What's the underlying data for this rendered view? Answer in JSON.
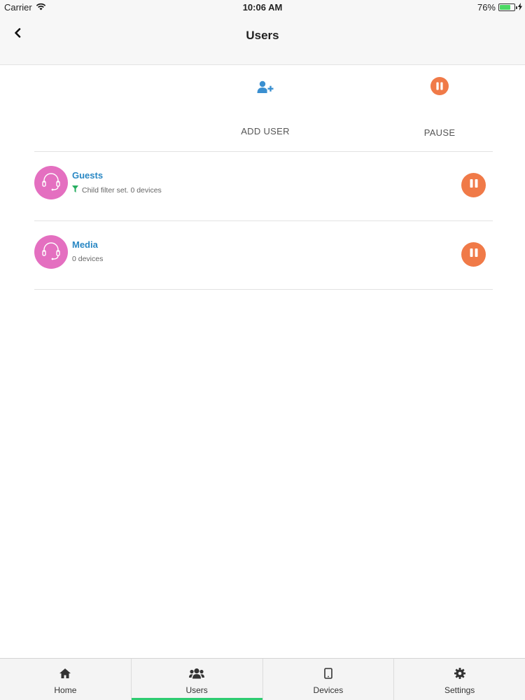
{
  "status_bar": {
    "carrier": "Carrier",
    "time": "10:06 AM",
    "battery": "76%",
    "battery_level": 0.76
  },
  "nav": {
    "title": "Users"
  },
  "actions": {
    "add_user_label": "ADD USER",
    "pause_label": "PAUSE",
    "add_user_icon": "add-user-icon",
    "pause_icon": "pause-icon"
  },
  "users": [
    {
      "name": "Guests",
      "subtitle": "Child filter set. 0 devices",
      "has_filter": true
    },
    {
      "name": "Media",
      "subtitle": "0 devices",
      "has_filter": false
    }
  ],
  "tabs": [
    {
      "label": "Home",
      "icon": "home-icon",
      "active": false
    },
    {
      "label": "Users",
      "icon": "users-icon",
      "active": true
    },
    {
      "label": "Devices",
      "icon": "tablet-icon",
      "active": false
    },
    {
      "label": "Settings",
      "icon": "gear-icon",
      "active": false
    }
  ],
  "colors": {
    "accent_blue": "#2a88c4",
    "pause_orange": "#f07a48",
    "avatar_pink": "#e46fc0",
    "active_tab_green": "#2ecc71",
    "filter_green": "#27ae60"
  }
}
